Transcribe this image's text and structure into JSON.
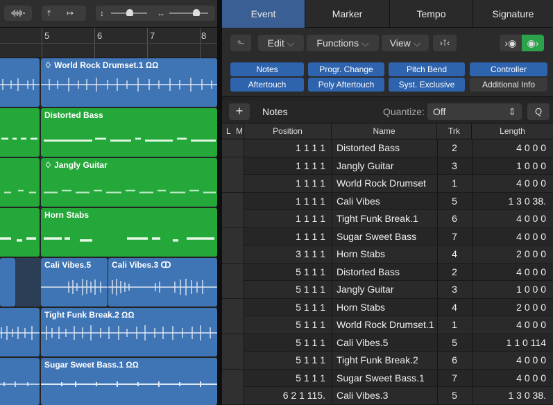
{
  "left_toolbar": {
    "waveform_icon": "waveform-icon",
    "fit_vertical_icon": "fit-vertical-icon",
    "fit_horizontal_icon": "fit-horizontal-icon",
    "vzoom_icon": "vertical-zoom-icon",
    "hzoom_icon": "horizontal-zoom-icon"
  },
  "ruler": {
    "bars": [
      "5",
      "6",
      "7",
      "8"
    ]
  },
  "regions": [
    {
      "label": "♢ World Rock Drumset.1 ΩΩ",
      "color": "blue"
    },
    {
      "label": "Distorted Bass",
      "color": "green"
    },
    {
      "label": "♢ Jangly Guitar",
      "color": "green"
    },
    {
      "label": "Horn Stabs",
      "color": "green"
    },
    {
      "label": "Cali Vibes.5",
      "color": "blue"
    },
    {
      "label": "Cali Vibes.3 ↀ",
      "color": "blue"
    },
    {
      "label": "Tight Funk Break.2 ΩΩ",
      "color": "blue"
    },
    {
      "label": "Sugar Sweet Bass.1 ΩΩ",
      "color": "blue"
    }
  ],
  "tabs": [
    "Event",
    "Marker",
    "Tempo",
    "Signature"
  ],
  "active_tab": "Event",
  "menus": {
    "edit": "Edit",
    "functions": "Functions",
    "view": "View",
    "filter": "›⊺‹"
  },
  "filters": [
    "Notes",
    "Progr. Change",
    "Pitch Bend",
    "Controller",
    "Aftertouch",
    "Poly Aftertouch",
    "Syst. Exclusive",
    "Additional Info"
  ],
  "list": {
    "add_label": "+",
    "type_label": "Notes",
    "quantize_label": "Quantize:",
    "quantize_value": "Off",
    "search_label": "Q"
  },
  "columns": {
    "lm_l": "L",
    "lm_m": "M",
    "position": "Position",
    "name": "Name",
    "trk": "Trk",
    "length": "Length"
  },
  "events": [
    {
      "pos": "1 1 1     1",
      "name": "Distorted Bass",
      "trk": "2",
      "len": "4 0 0     0"
    },
    {
      "pos": "1 1 1     1",
      "name": "Jangly Guitar",
      "trk": "3",
      "len": "1 0 0     0"
    },
    {
      "pos": "1 1 1     1",
      "name": "World Rock Drumset",
      "trk": "1",
      "len": "4 0 0     0"
    },
    {
      "pos": "1 1 1     1",
      "name": "Cali Vibes",
      "trk": "5",
      "len": "1 3 0   38."
    },
    {
      "pos": "1 1 1     1",
      "name": "Tight Funk Break.1",
      "trk": "6",
      "len": "4 0 0     0"
    },
    {
      "pos": "1 1 1     1",
      "name": "Sugar Sweet Bass",
      "trk": "7",
      "len": "4 0 0     0"
    },
    {
      "pos": "3 1 1     1",
      "name": "Horn Stabs",
      "trk": "4",
      "len": "2 0 0     0"
    },
    {
      "pos": "5 1 1     1",
      "name": "Distorted Bass",
      "trk": "2",
      "len": "4 0 0     0"
    },
    {
      "pos": "5 1 1     1",
      "name": "Jangly Guitar",
      "trk": "3",
      "len": "1 0 0     0"
    },
    {
      "pos": "5 1 1     1",
      "name": "Horn Stabs",
      "trk": "4",
      "len": "2 0 0     0"
    },
    {
      "pos": "5 1 1     1",
      "name": "World Rock Drumset.1",
      "trk": "1",
      "len": "4 0 0     0"
    },
    {
      "pos": "5 1 1     1",
      "name": "Cali Vibes.5",
      "trk": "5",
      "len": "1 1 0 114"
    },
    {
      "pos": "5 1 1     1",
      "name": "Tight Funk Break.2",
      "trk": "6",
      "len": "4 0 0     0"
    },
    {
      "pos": "5 1 1     1",
      "name": "Sugar Sweet Bass.1",
      "trk": "7",
      "len": "4 0 0     0"
    },
    {
      "pos": "6 2 1 115.",
      "name": "Cali Vibes.3",
      "trk": "5",
      "len": "1 3 0   38."
    }
  ]
}
